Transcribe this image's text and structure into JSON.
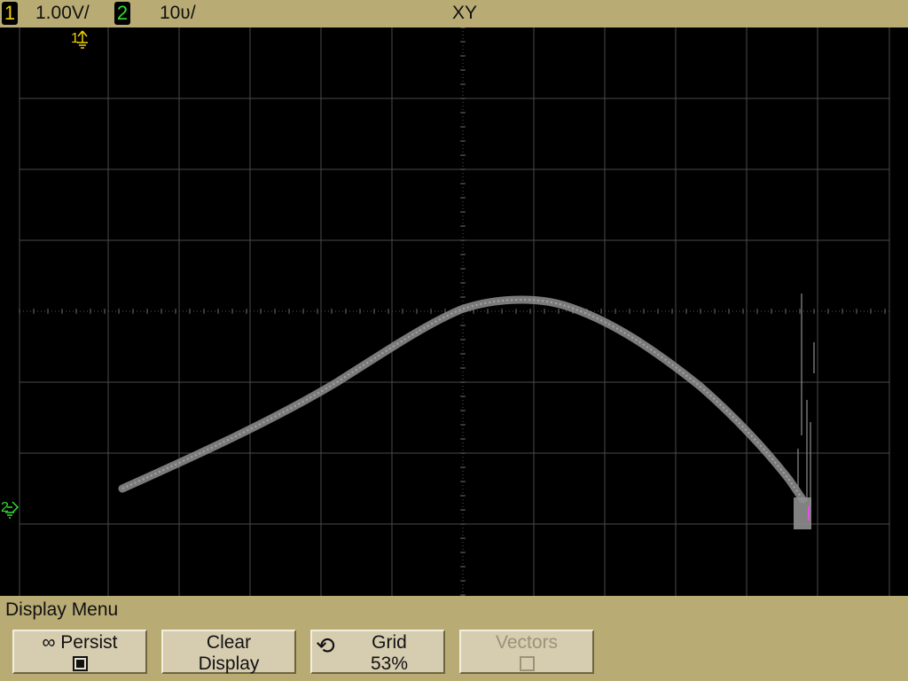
{
  "status_bar": {
    "ch1_number": "1",
    "ch1_scale": "1.00V/",
    "ch2_number": "2",
    "ch2_scale": "10ʋ/",
    "mode": "XY",
    "ch1_color": "#f0d000",
    "ch2_color": "#33dd33"
  },
  "screen": {
    "ch1_marker": "1",
    "ch2_marker": "2",
    "grid_color": "#4a4a4a",
    "trace_color": "#8f8f8f",
    "marker_tick_color": "#ff44ff"
  },
  "display_menu": {
    "title": "Display Menu",
    "softkeys": [
      {
        "icon": "infinity-icon",
        "line1": "∞ Persist",
        "checkbox": "checked",
        "enabled": true
      },
      {
        "line1": "Clear",
        "line2": "Display",
        "enabled": true
      },
      {
        "icon": "rotate-arrow-icon",
        "line1": "Grid",
        "line2": "53%",
        "enabled": true
      },
      {
        "line1": "Vectors",
        "checkbox": "unchecked",
        "enabled": false
      }
    ]
  }
}
